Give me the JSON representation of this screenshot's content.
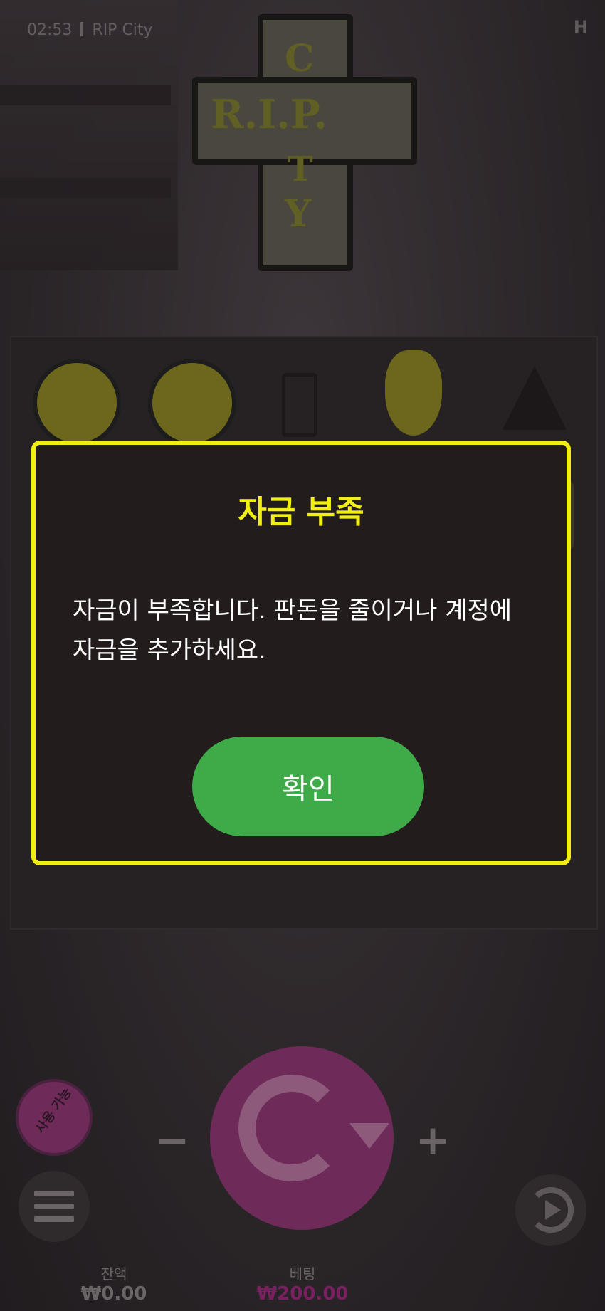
{
  "statusbar": {
    "time": "02:53",
    "app_title": "RIP City",
    "corner_mark": "H"
  },
  "logo": {
    "line1": "C",
    "line2": "R.I.P.",
    "line3": "T",
    "line4": "Y"
  },
  "dialog": {
    "title": "자금 부족",
    "message_line1": "자금이 부족합니다. 판돈을 줄이거나 계정에",
    "message_line2": "자금을 추가하세요.",
    "confirm_label": "확인"
  },
  "controls": {
    "minus_label": "−",
    "plus_label": "+",
    "autoplay_label": "사용 가능"
  },
  "footer": {
    "balance_label": "잔액",
    "balance_value": "₩0.00",
    "bet_label": "베팅",
    "bet_value": "₩200.00"
  },
  "colors": {
    "accent_yellow": "#f1ee14",
    "confirm_green": "#3faa48",
    "spin_magenta": "#6e2a58",
    "bet_value_color": "#7a2060"
  }
}
